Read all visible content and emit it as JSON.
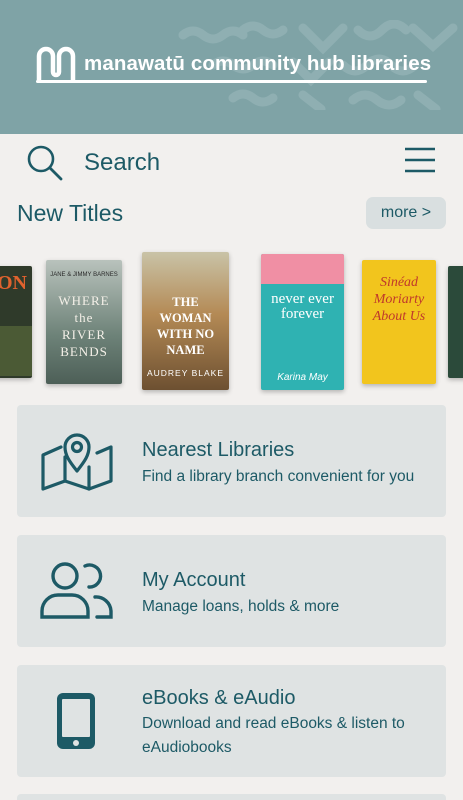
{
  "header": {
    "brand": "manawatū community hub libraries"
  },
  "search": {
    "label": "Search"
  },
  "new_titles": {
    "heading": "New Titles",
    "more_label": "more >",
    "books": [
      {
        "title": "ON",
        "author": "",
        "color": "#2f3a2a"
      },
      {
        "title": "WHERE the RIVER BENDS",
        "author": "JANE & JIMMY BARNES",
        "color": "#7e9187"
      },
      {
        "title": "THE WOMAN WITH NO NAME",
        "author": "AUDREY BLAKE",
        "color": "#a0764f"
      },
      {
        "title": "never ever forever",
        "author": "Karina May",
        "color": "#2fb2b2"
      },
      {
        "title": "Sinéad Moriarty About Us",
        "author": "",
        "color": "#f2c51d"
      },
      {
        "title": "",
        "author": "",
        "color": "#2b4a3a"
      }
    ]
  },
  "cards": [
    {
      "title": "Nearest Libraries",
      "subtitle": "Find a library branch convenient for you",
      "icon": "map-pin-icon"
    },
    {
      "title": "My Account",
      "subtitle": "Manage loans, holds & more",
      "icon": "users-icon"
    },
    {
      "title": "eBooks & eAudio",
      "subtitle": "Download and read eBooks & listen to eAudiobooks",
      "icon": "tablet-icon"
    }
  ]
}
